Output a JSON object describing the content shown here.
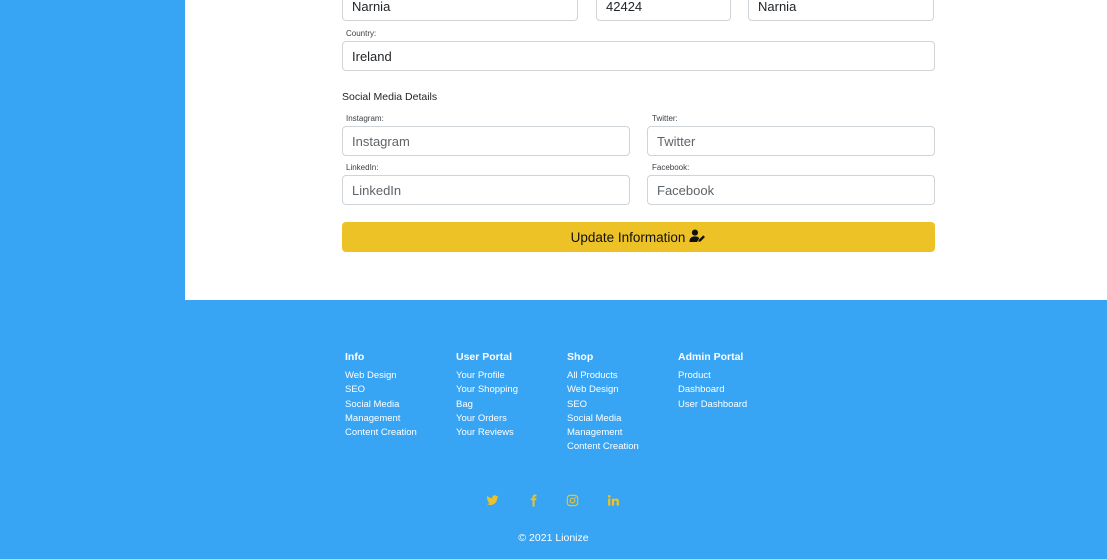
{
  "address": {
    "city": "Narnia",
    "postcode": "42424",
    "county": "Narnia",
    "country_label": "Country:",
    "country": "Ireland"
  },
  "social_details": {
    "title": "Social Media Details",
    "instagram_label": "Instagram:",
    "instagram_placeholder": "Instagram",
    "twitter_label": "Twitter:",
    "twitter_placeholder": "Twitter",
    "linkedin_label": "LinkedIn:",
    "linkedin_placeholder": "LinkedIn",
    "facebook_label": "Facebook:",
    "facebook_placeholder": "Facebook"
  },
  "update_button": {
    "label": "Update Information",
    "icon": "user-edit-icon"
  },
  "footer": {
    "info": {
      "heading": "Info",
      "links": [
        "Web Design",
        "SEO",
        "Social Media Management",
        "Content Creation"
      ]
    },
    "user_portal": {
      "heading": "User Portal",
      "links": [
        "Your Profile",
        "Your Shopping Bag",
        "Your Orders",
        "Your Reviews"
      ]
    },
    "shop": {
      "heading": "Shop",
      "links": [
        "All Products",
        "Web Design",
        "SEO",
        "Social Media Management",
        "Content Creation"
      ]
    },
    "admin_portal": {
      "heading": "Admin Portal",
      "links": [
        "Product Dashboard",
        "User Dashboard"
      ]
    },
    "social_icons": [
      "twitter-icon",
      "facebook-icon",
      "instagram-icon",
      "linkedin-icon"
    ],
    "copyright": "© 2021 Lionize"
  },
  "colors": {
    "background": "#37a4f4",
    "accent": "#edc227",
    "panel": "#ffffff"
  }
}
